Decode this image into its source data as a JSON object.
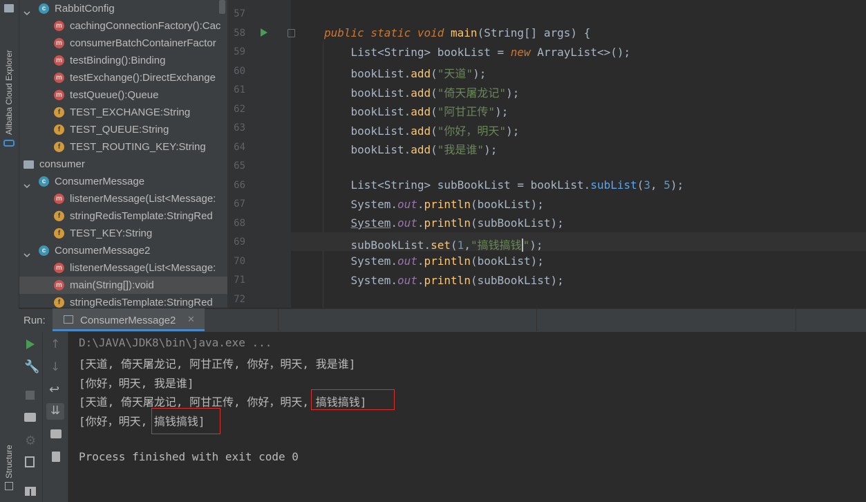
{
  "left_strip": {
    "cloud_explorer_label": "Alibaba Cloud Explorer",
    "structure_label": "Structure"
  },
  "tree": {
    "items": [
      {
        "label": "RabbitConfig",
        "icon": "class-icon",
        "kind": "c",
        "expand": true
      },
      {
        "label": "cachingConnectionFactory():Cac",
        "icon": "method-icon",
        "kind": "m"
      },
      {
        "label": "consumerBatchContainerFactor",
        "icon": "method-icon",
        "kind": "m"
      },
      {
        "label": "testBinding():Binding",
        "icon": "method-icon",
        "kind": "m"
      },
      {
        "label": "testExchange():DirectExchange",
        "icon": "method-icon",
        "kind": "m"
      },
      {
        "label": "testQueue():Queue",
        "icon": "method-icon",
        "kind": "m"
      },
      {
        "label": "TEST_EXCHANGE:String",
        "icon": "field-icon",
        "kind": "f"
      },
      {
        "label": "TEST_QUEUE:String",
        "icon": "field-icon",
        "kind": "f"
      },
      {
        "label": "TEST_ROUTING_KEY:String",
        "icon": "field-icon",
        "kind": "f"
      },
      {
        "label": "consumer",
        "icon": "package-icon",
        "kind": "p"
      },
      {
        "label": "ConsumerMessage",
        "icon": "class-icon",
        "kind": "c",
        "expand": true
      },
      {
        "label": "listenerMessage(List<Message:",
        "icon": "method-icon",
        "kind": "m"
      },
      {
        "label": "stringRedisTemplate:StringRed",
        "icon": "field-icon",
        "kind": "f"
      },
      {
        "label": "TEST_KEY:String",
        "icon": "field-icon",
        "kind": "f"
      },
      {
        "label": "ConsumerMessage2",
        "icon": "runnable-class-icon",
        "kind": "c",
        "expand": true
      },
      {
        "label": "listenerMessage(List<Message:",
        "icon": "method-icon",
        "kind": "m"
      },
      {
        "label": "main(String[]):void",
        "icon": "method-icon",
        "kind": "m",
        "selected": true
      },
      {
        "label": "stringRedisTemplate:StringRed",
        "icon": "field-icon",
        "kind": "f"
      }
    ]
  },
  "editor": {
    "line_numbers": [
      "57",
      "58",
      "59",
      "60",
      "61",
      "62",
      "63",
      "64",
      "65",
      "66",
      "67",
      "68",
      "69",
      "70",
      "71",
      "72"
    ],
    "str_tiandao": "\"天道\"",
    "str_yitian": "\"倚天屠龙记\"",
    "str_agan": "\"阿甘正传\"",
    "str_nihao": "\"你好，明天\"",
    "str_woshi": "\"我是谁\"",
    "str_gaoqian_a": "\"搞钱搞钱",
    "str_gaoqian_b": "\"",
    "num_3": "3",
    "num_5": "5",
    "num_1": "1"
  },
  "run": {
    "run_label": "Run:",
    "tab_label": "ConsumerMessage2",
    "console": [
      "D:\\JAVA\\JDK8\\bin\\java.exe ...",
      "[天道, 倚天屠龙记, 阿甘正传, 你好，明天, 我是谁]",
      "[你好，明天, 我是谁]",
      "[天道, 倚天屠龙记, 阿甘正传, 你好，明天, 搞钱搞钱]",
      "[你好，明天, 搞钱搞钱]",
      "",
      "Process finished with exit code 0"
    ]
  },
  "colors": {
    "accent": "#4a88c7",
    "highlight_box": "#e0302b"
  }
}
